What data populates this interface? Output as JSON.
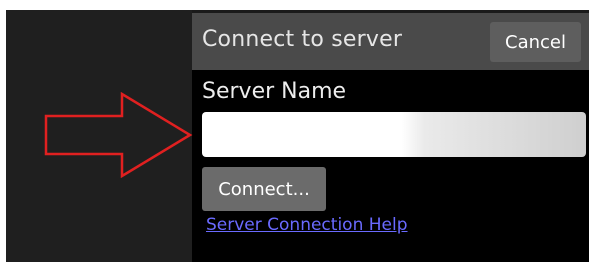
{
  "dialog": {
    "title": "Connect to server",
    "cancel_label": "Cancel",
    "server_name_label": "Server Name",
    "server_name_value": "",
    "connect_label": "Connect...",
    "help_link": "Server Connection Help"
  },
  "annotation": {
    "icon": "arrow-right-icon",
    "color": "#e02020"
  },
  "colors": {
    "dialog_header": "#4a4a4a",
    "dialog_body": "#000000",
    "link": "#6a6aff"
  }
}
